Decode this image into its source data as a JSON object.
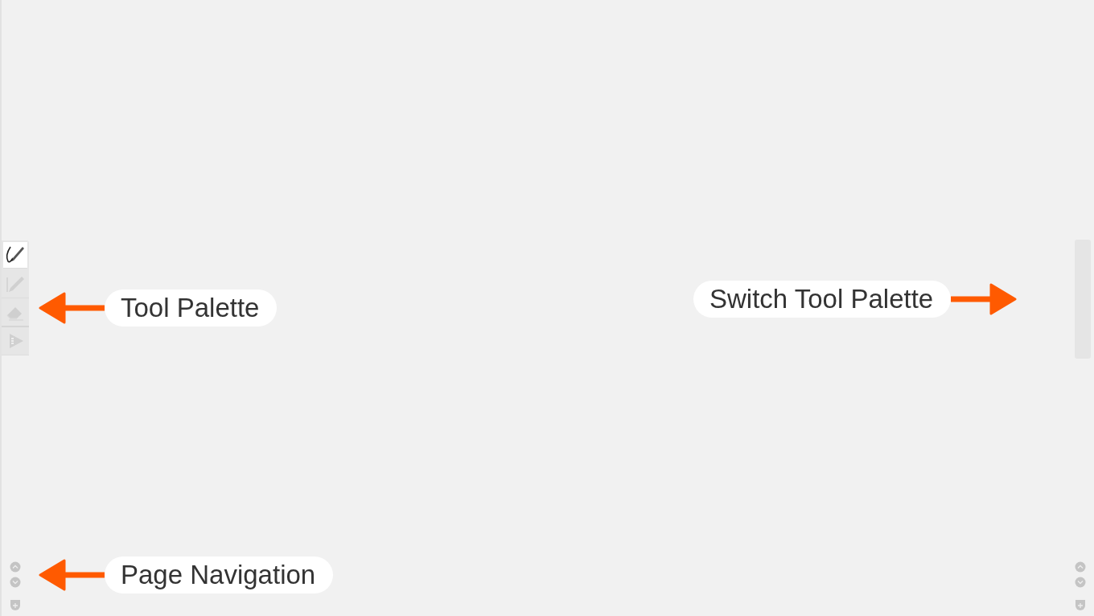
{
  "tool_palette": {
    "tools": [
      {
        "kind": "pen",
        "selected": true
      },
      {
        "kind": "pencil",
        "selected": false
      },
      {
        "kind": "eraser",
        "selected": false
      },
      {
        "kind": "more",
        "selected": false
      }
    ]
  },
  "callouts": [
    {
      "label": "Tool Palette",
      "kind": "pointleft"
    },
    {
      "label": "Switch Tool Palette",
      "kind": "pointright"
    },
    {
      "label": "Page Navigation",
      "kind": "pointleft"
    }
  ]
}
